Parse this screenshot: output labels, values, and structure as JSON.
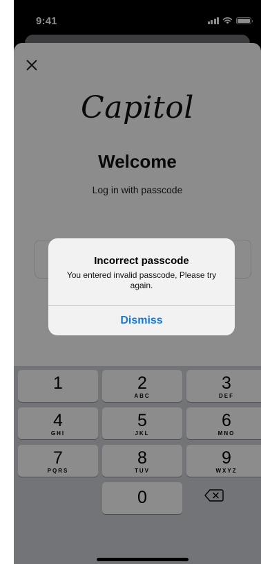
{
  "status_bar": {
    "time": "9:41"
  },
  "brand": {
    "logo_text": "Capitol"
  },
  "login": {
    "title": "Welcome",
    "subtitle": "Log in with passcode"
  },
  "keypad": {
    "keys": [
      {
        "number": "1",
        "letters": ""
      },
      {
        "number": "2",
        "letters": "ABC"
      },
      {
        "number": "3",
        "letters": "DEF"
      },
      {
        "number": "4",
        "letters": "GHI"
      },
      {
        "number": "5",
        "letters": "JKL"
      },
      {
        "number": "6",
        "letters": "MNO"
      },
      {
        "number": "7",
        "letters": "PQRS"
      },
      {
        "number": "8",
        "letters": "TUV"
      },
      {
        "number": "9",
        "letters": "WXYZ"
      },
      {
        "number": "0",
        "letters": ""
      }
    ],
    "backspace_icon": "backspace-icon"
  },
  "alert": {
    "title": "Incorrect passcode",
    "message": "You entered invalid passcode, Please try again.",
    "dismiss_label": "Dismiss",
    "action_color": "#1878d6"
  },
  "colors": {
    "keypad_bg": "#d1d4d9",
    "overlay": "rgba(0,0,0,0.45)"
  }
}
